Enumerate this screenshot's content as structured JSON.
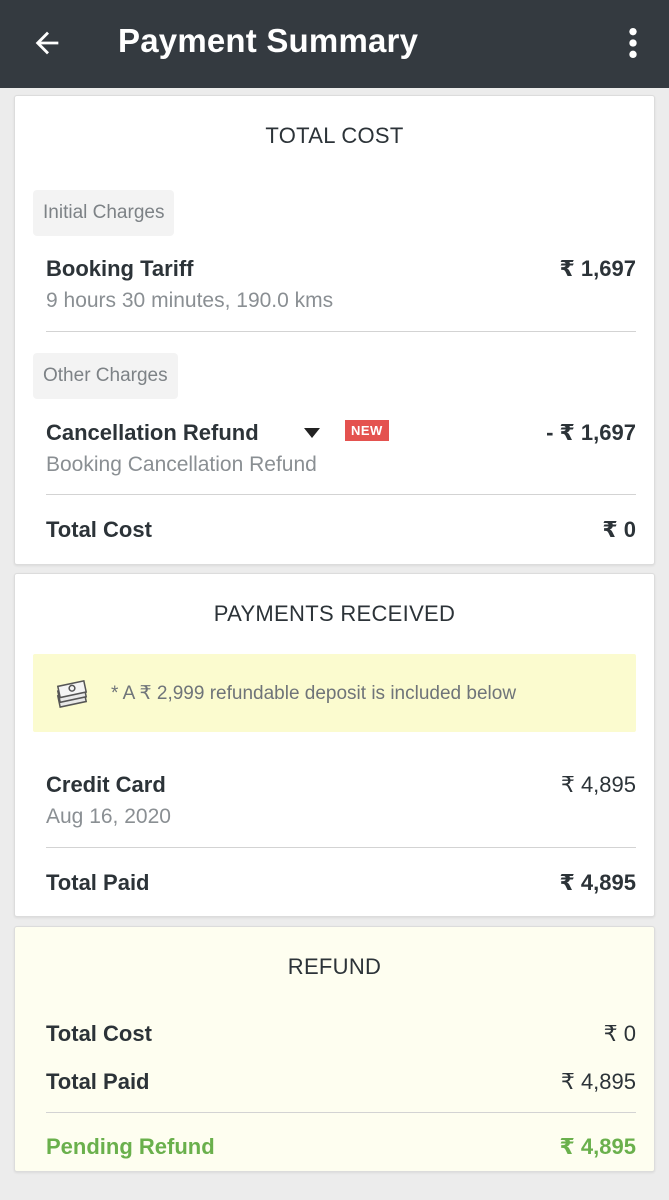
{
  "header": {
    "title": "Payment Summary"
  },
  "total_cost_card": {
    "title": "TOTAL COST",
    "initial_charges_label": "Initial Charges",
    "booking_tariff": {
      "label": "Booking Tariff",
      "sub": "9 hours 30 minutes, 190.0 kms",
      "value": "₹ 1,697"
    },
    "other_charges_label": "Other Charges",
    "cancellation_refund": {
      "label": "Cancellation Refund",
      "badge": "NEW",
      "sub": "Booking Cancellation Refund",
      "value": "- ₹ 1,697"
    },
    "total": {
      "label": "Total Cost",
      "value": "₹ 0"
    }
  },
  "payments_card": {
    "title": "PAYMENTS RECEIVED",
    "notice": "* A ₹ 2,999 refundable deposit is included below",
    "credit_card": {
      "label": "Credit Card",
      "sub": "Aug 16, 2020",
      "value": "₹ 4,895"
    },
    "total": {
      "label": "Total Paid",
      "value": "₹ 4,895"
    }
  },
  "refund_card": {
    "title": "REFUND",
    "total_cost": {
      "label": "Total Cost",
      "value": "₹ 0"
    },
    "total_paid": {
      "label": "Total Paid",
      "value": "₹ 4,895"
    },
    "pending": {
      "label": "Pending Refund",
      "value": "₹ 4,895"
    }
  },
  "colors": {
    "appbar": "#343a40",
    "badge": "#e4524f",
    "pending_green": "#6ab04c",
    "notice_bg": "#fbfbcf"
  },
  "icons": [
    "back-arrow-icon",
    "more-vert-icon",
    "money-stack-icon",
    "caret-down-icon"
  ]
}
